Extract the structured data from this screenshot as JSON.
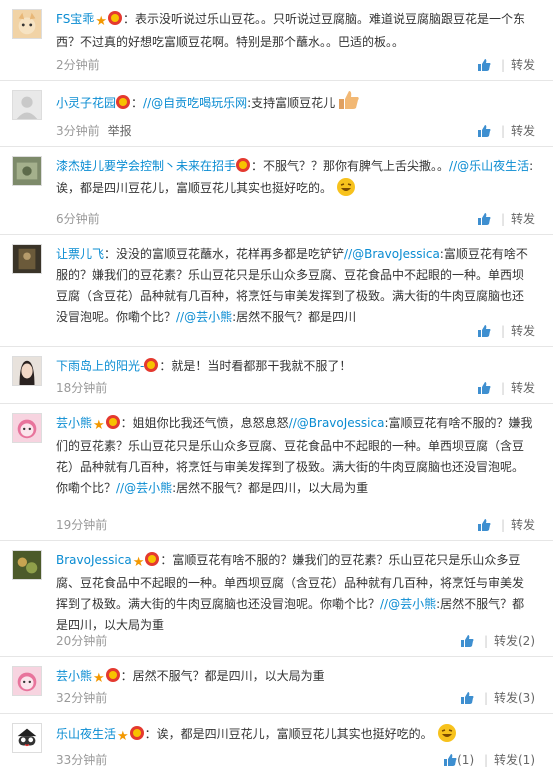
{
  "comments": [
    {
      "user": "FS宝乖",
      "text": "：表示没听说过乐山豆花。。只听说过豆腐脑。难道说豆腐脑跟豆花是一个东西？不过真的好想吃富顺豆花啊。特别是那个蘸水。。巴适的板。。",
      "time": "2分钟前",
      "like": "",
      "repost": "转发"
    },
    {
      "user": "小灵子花园",
      "pre": "：",
      "mention": "//@自贡吃喝玩乐网",
      "text": ":支持富顺豆花儿",
      "time": "3分钟前",
      "report": "举报",
      "like": "",
      "repost": "转发"
    },
    {
      "user": "漆杰娃儿要学会控制丶未来在招手",
      "text": "：不服气？？那你有脾气上舌尖撒。。",
      "mention": "//@乐山夜生活",
      "text2": ":诶，都是四川豆花儿，富顺豆花儿其实也挺好吃的。",
      "time": "6分钟前",
      "like": "",
      "repost": "转发"
    },
    {
      "user": "让票儿飞",
      "text": "：没没的富顺豆花蘸水，花样再多都是吃铲铲",
      "mention": "//@BravoJessica",
      "text2": ":富顺豆花有啥不服的？嫌我们的豆花素？乐山豆花只是乐山众多豆腐、豆花食品中不起眼的一种。单西坝豆腐（含豆花）品种就有几百种，将烹饪与审美发挥到了极致。满大街的牛肉豆腐脑也还没冒泡呢。你嘞个比？",
      "mention2": "//@芸小熊",
      "text3": ":居然不服气？都是四川",
      "time": "",
      "like": "",
      "repost": "转发"
    },
    {
      "user": "下雨岛上的阳光-",
      "text": "：就是！当时看都那干我就不服了！",
      "time": "18分钟前",
      "like": "",
      "repost": "转发"
    },
    {
      "user": "芸小熊",
      "text": "：姐姐你比我还气愤，息怒息怒",
      "mention": "//@BravoJessica",
      "text2": ":富顺豆花有啥不服的？嫌我们的豆花素？乐山豆花只是乐山众多豆腐、豆花食品中不起眼的一种。单西坝豆腐（含豆花）品种就有几百种，将烹饪与审美发挥到了极致。满大街的牛肉豆腐脑也还没冒泡呢。你嘞个比？",
      "mention2": "//@芸小熊",
      "text3": ":居然不服气？都是四川，以大局为重",
      "time": "19分钟前",
      "like": "",
      "repost": "转发"
    },
    {
      "user": "BravoJessica",
      "text": "：富顺豆花有啥不服的？嫌我们的豆花素？乐山豆花只是乐山众多豆腐、豆花食品中不起眼的一种。单西坝豆腐（含豆花）品种就有几百种，将烹饪与审美发挥到了极致。满大街的牛肉豆腐脑也还没冒泡呢。你嘞个比？",
      "mention": "//@芸小熊",
      "text2": ":居然不服气？都是四川，以大局为重",
      "time": "20分钟前",
      "like": "",
      "repost": "转发(2)"
    },
    {
      "user": "芸小熊",
      "text": "：居然不服气？都是四川，以大局为重",
      "time": "32分钟前",
      "like": "",
      "repost": "转发(3)"
    },
    {
      "user": "乐山夜生活",
      "text": "：诶，都是四川豆花儿，富顺豆花儿其实也挺好吃的。",
      "time": "33分钟前",
      "like": "(1)",
      "repost": "转发(1)"
    }
  ],
  "colors": {
    "link": "#0a8cd2",
    "meta": "#999999",
    "border": "#e6e6e6",
    "star": "#f39800"
  }
}
